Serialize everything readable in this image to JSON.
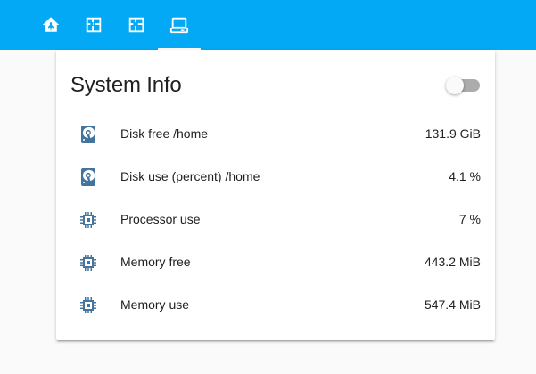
{
  "colors": {
    "toolbar": "#03a9f4",
    "icon": "#44739e",
    "text": "#212121"
  },
  "tabs": [
    {
      "icon": "home-assistant-icon",
      "active": false
    },
    {
      "icon": "floorplan-icon",
      "active": false
    },
    {
      "icon": "floorplan-icon",
      "active": false
    },
    {
      "icon": "server-computer-icon",
      "active": true
    }
  ],
  "card": {
    "title": "System Info",
    "toggle_on": false,
    "rows": [
      {
        "icon": "harddisk-icon",
        "label": "Disk free /home",
        "value": "131.9 GiB"
      },
      {
        "icon": "harddisk-icon",
        "label": "Disk use (percent) /home",
        "value": "4.1 %"
      },
      {
        "icon": "chip-icon",
        "label": "Processor use",
        "value": "7 %"
      },
      {
        "icon": "chip-icon",
        "label": "Memory free",
        "value": "443.2 MiB"
      },
      {
        "icon": "chip-icon",
        "label": "Memory use",
        "value": "547.4 MiB"
      }
    ]
  }
}
